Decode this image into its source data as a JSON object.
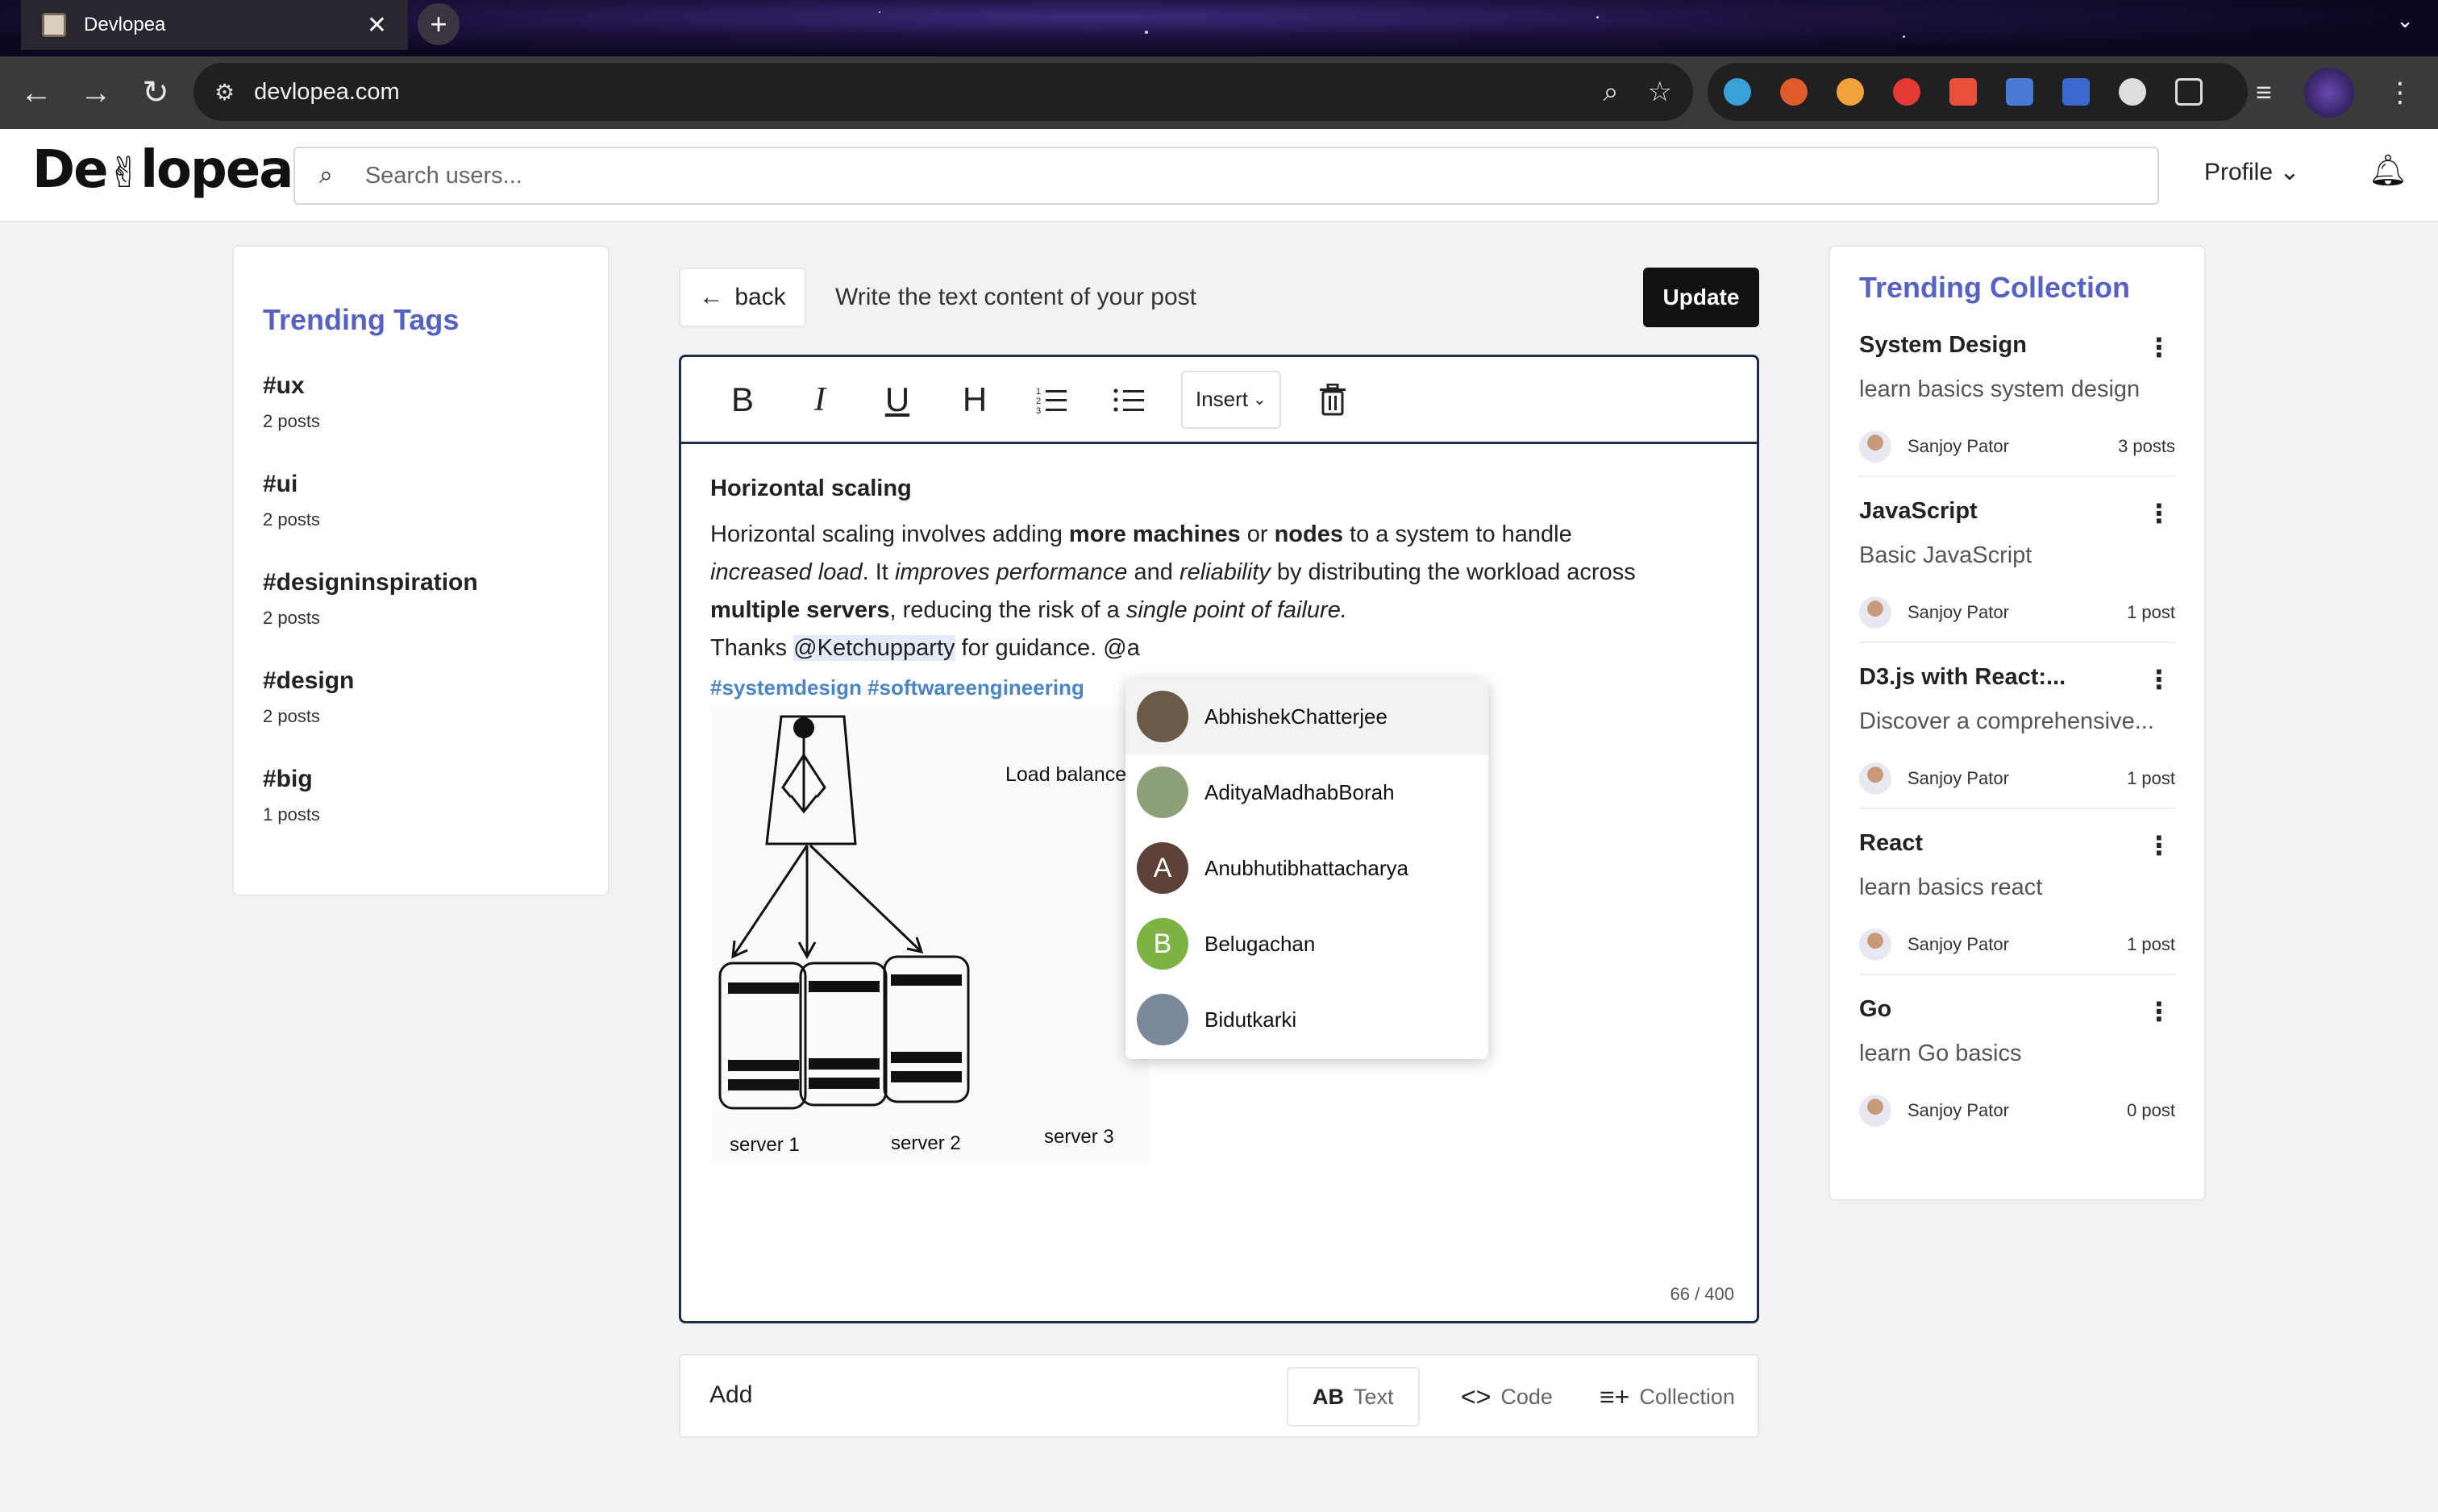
{
  "browser": {
    "tab_title": "Devlopea",
    "tab_close": "✕",
    "new_tab": "+",
    "url": "devlopea.com"
  },
  "header": {
    "logo_part1": "De",
    "logo_part2": "lopea",
    "search_placeholder": "Search users...",
    "profile_label": "Profile ⌄"
  },
  "trending_tags": {
    "title": "Trending Tags",
    "items": [
      {
        "tag": "#ux",
        "count": "2 posts"
      },
      {
        "tag": "#ui",
        "count": "2 posts"
      },
      {
        "tag": "#designinspiration",
        "count": "2 posts"
      },
      {
        "tag": "#design",
        "count": "2 posts"
      },
      {
        "tag": "#big",
        "count": "1 posts"
      }
    ]
  },
  "editor_bar": {
    "back_label": "back",
    "hint": "Write the text content of your post",
    "update_label": "Update"
  },
  "toolbar": {
    "bold": "B",
    "italic": "I",
    "underline": "U",
    "heading": "H",
    "insert_label": "Insert"
  },
  "post": {
    "heading": "Horizontal scaling",
    "p1_a": "Horizontal scaling involves adding ",
    "p1_b": "more machines",
    "p1_c": " or ",
    "p1_d": "nodes",
    "p1_e": " to a system to handle ",
    "p1_f": "increased load",
    "p1_g": ". It ",
    "p1_h": "improves performance",
    "p1_i": " and ",
    "p1_j": "reliability",
    "p1_k": " by distributing the workload across ",
    "p1_l": "multiple servers",
    "p1_m": ", reducing the risk of a ",
    "p1_n": "single point of failure.",
    "p2_a": "Thanks ",
    "p2_mention": "@Ketchupparty",
    "p2_b": " for guidance. @a",
    "hashtags": "#systemdesign #softwareengineering",
    "char_count": "66 / 400"
  },
  "diagram": {
    "lb_label": "Load balancer",
    "server1": "server 1",
    "server2": "server 2",
    "server3": "server 3"
  },
  "mentions": [
    {
      "name": "AbhishekChatterjee",
      "initial": "",
      "color": "#6b5a48"
    },
    {
      "name": "AdityaMadhabBorah",
      "initial": "",
      "color": "#8ea07a"
    },
    {
      "name": "Anubhutibhattacharya",
      "initial": "A",
      "color": "#5d4037"
    },
    {
      "name": "Belugachan",
      "initial": "B",
      "color": "#7cb342"
    },
    {
      "name": "Bidutkarki",
      "initial": "",
      "color": "#7a8a9a"
    }
  ],
  "add_bar": {
    "label": "Add",
    "text_icon": "AB",
    "text_label": "Text",
    "code_icon": "<>",
    "code_label": "Code",
    "collection_label": "Collection"
  },
  "trending_collection": {
    "title": "Trending Collection",
    "items": [
      {
        "title": "System Design",
        "desc": "learn basics system design",
        "author": "Sanjoy Pator",
        "count": "3 posts"
      },
      {
        "title": "JavaScript",
        "desc": "Basic JavaScript",
        "author": "Sanjoy Pator",
        "count": "1 post"
      },
      {
        "title": "D3.js with React:...",
        "desc": "Discover a comprehensive...",
        "author": "Sanjoy Pator",
        "count": "1 post"
      },
      {
        "title": "React",
        "desc": "learn basics react",
        "author": "Sanjoy Pator",
        "count": "1 post"
      },
      {
        "title": "Go",
        "desc": "learn Go basics",
        "author": "Sanjoy Pator",
        "count": "0 post"
      }
    ]
  }
}
